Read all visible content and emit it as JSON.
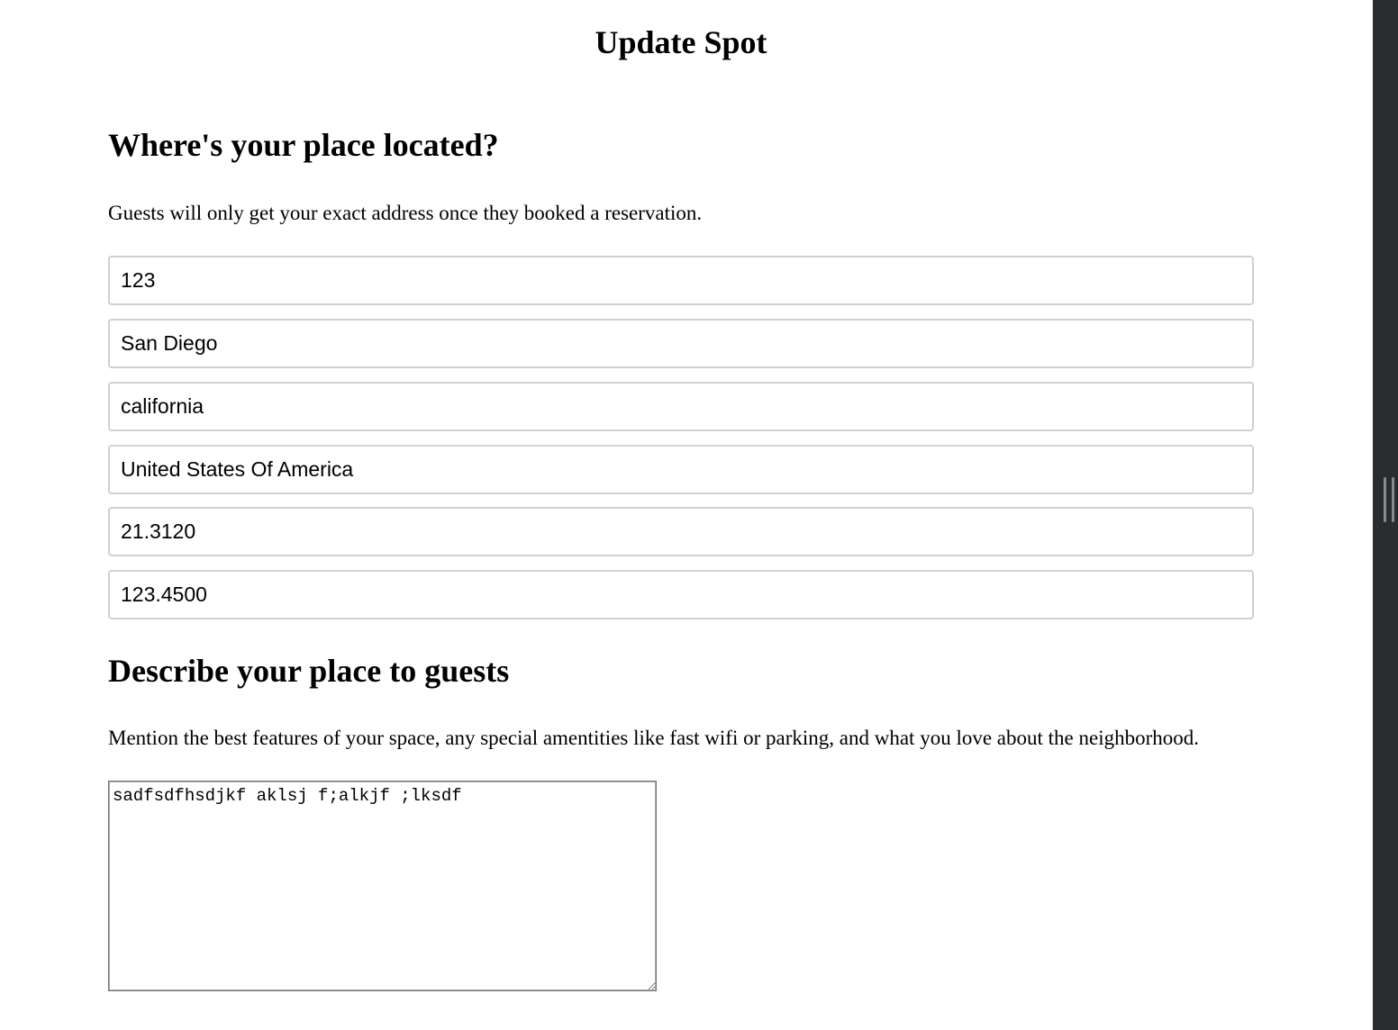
{
  "page": {
    "title": "Update Spot"
  },
  "location_section": {
    "heading": "Where's your place located?",
    "description": "Guests will only get your exact address once they booked a reservation.",
    "fields": {
      "address": "123",
      "city": "San Diego",
      "state": "california",
      "country": "United States Of America",
      "latitude": "21.3120",
      "longitude": "123.4500"
    }
  },
  "description_section": {
    "heading": "Describe your place to guests",
    "description": "Mention the best features of your space, any special amentities like fast wifi or parking, and what you love about the neighborhood.",
    "textarea_value": "sadfsdfhsdjkf aklsj f;alkjf ;lksdf"
  },
  "colors": {
    "background": "#ffffff",
    "input_border": "#d0d0d0",
    "sidebar": "#2b2c2f"
  }
}
